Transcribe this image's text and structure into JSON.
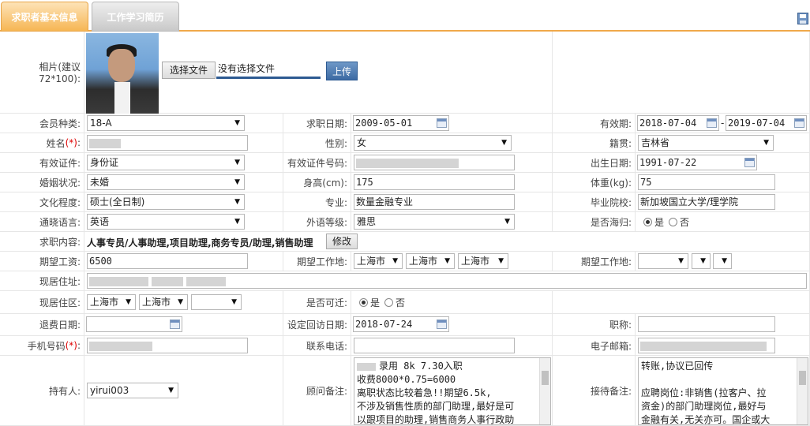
{
  "tabs": {
    "basic": "求职者基本信息",
    "history": "工作学习简历"
  },
  "photo": {
    "label": "相片(建议72*100):",
    "choose_file": "选择文件",
    "no_file": "没有选择文件",
    "upload": "上传"
  },
  "fields": {
    "member_type": {
      "label": "会员种类:",
      "value": "18-A"
    },
    "job_date": {
      "label": "求职日期:",
      "value": "2009-05-01"
    },
    "valid_period": {
      "label": "有效期:",
      "from": "2018-07-04",
      "sep": "-",
      "to": "2019-07-04"
    },
    "name": {
      "label": "姓名",
      "req": "(*)",
      "colon": ":"
    },
    "gender": {
      "label": "性别:",
      "value": "女"
    },
    "native_place": {
      "label": "籍贯:",
      "value": "吉林省"
    },
    "id_type": {
      "label": "有效证件:",
      "value": "身份证"
    },
    "id_number": {
      "label": "有效证件号码:"
    },
    "birth_date": {
      "label": "出生日期:",
      "value": "1991-07-22"
    },
    "marital": {
      "label": "婚姻状况:",
      "value": "未婚"
    },
    "height": {
      "label": "身高(cm):",
      "value": "175"
    },
    "weight": {
      "label": "体重(kg):",
      "value": "75"
    },
    "education": {
      "label": "文化程度:",
      "value": "硕士(全日制)"
    },
    "major": {
      "label": "专业:",
      "value": "数量金融专业"
    },
    "school": {
      "label": "毕业院校:",
      "value": "新加坡国立大学/理学院"
    },
    "language": {
      "label": "通晓语言:",
      "value": "英语"
    },
    "language_level": {
      "label": "外语等级:",
      "value": "雅思"
    },
    "returnee": {
      "label": "是否海归:",
      "yes": "是",
      "no": "否",
      "selected": "yes"
    },
    "job_content": {
      "label": "求职内容:",
      "value": "人事专员/人事助理,项目助理,商务专员/助理,销售助理",
      "edit": "修改"
    },
    "salary": {
      "label": "期望工资:",
      "value": "6500"
    },
    "work_place1": {
      "label": "期望工作地:",
      "province": "上海市",
      "city": "上海市",
      "district": "上海市"
    },
    "work_place2": {
      "label": "期望工作地:"
    },
    "address": {
      "label": "现居住址:"
    },
    "residence_area": {
      "label": "现居住区:",
      "province": "上海市",
      "city": "上海市"
    },
    "relocate": {
      "label": "是否可迁:",
      "yes": "是",
      "no": "否",
      "selected": "yes"
    },
    "refund_date": {
      "label": "退费日期:"
    },
    "visit_date": {
      "label": "设定回访日期:",
      "value": "2018-07-24"
    },
    "title": {
      "label": "职称:"
    },
    "mobile": {
      "label": "手机号码",
      "req": "(*)",
      "colon": ":"
    },
    "phone": {
      "label": "联系电话:"
    },
    "email": {
      "label": "电子邮箱:"
    },
    "holder": {
      "label": "持有人:",
      "value": "yirui003"
    },
    "consultant_note": {
      "label": "顾问备注:",
      "lines": [
        "录用 8k 7.30入职",
        "收费8000*0.75=6000",
        "离职状态比较着急!!期望6.5k,",
        "不涉及销售性质的部门助理,最好是可",
        "以跟项目的助理,销售商务人事行政助"
      ]
    },
    "reception_note": {
      "label": "接待备注:",
      "lines": [
        "转账,协议已回传",
        "",
        "应聘岗位:非销售(拉客户、拉",
        "资金)的部门助理岗位,最好与",
        "金融有关,无关亦可。国企或大"
      ]
    }
  }
}
